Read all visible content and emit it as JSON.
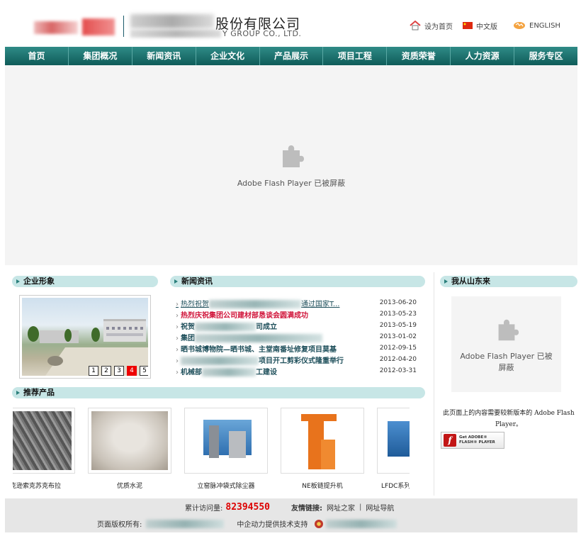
{
  "header": {
    "company_cn": "股份有限公司",
    "company_en": "Y GROUP CO., LTD.",
    "top_links": [
      {
        "label": "设为首页",
        "icon": "home-icon"
      },
      {
        "label": "中文版",
        "icon": "china-flag-icon"
      },
      {
        "label": "ENGLISH",
        "icon": "globe-icon"
      }
    ]
  },
  "nav": [
    "首页",
    "集团概况",
    "新闻资讯",
    "企业文化",
    "产品展示",
    "项目工程",
    "资质荣誉",
    "人力资源",
    "服务专区"
  ],
  "flash_blocked": "Adobe Flash Player 已被屏蔽",
  "sections": {
    "company_image": "企业形象",
    "news": "新闻资讯",
    "products": "推荐产品",
    "shandong": "我从山东来"
  },
  "pager": [
    "1",
    "2",
    "3",
    "4",
    "5"
  ],
  "pager_active": 3,
  "news": [
    {
      "pre": "热烈祝贺",
      "post": "通过国家T...",
      "date": "2013-06-20"
    },
    {
      "pre": "热烈庆祝集团公司建材部恳谈会圆满成功",
      "post": "",
      "date": "2013-05-23"
    },
    {
      "pre": "祝贺",
      "post": "司成立",
      "date": "2013-05-19"
    },
    {
      "pre": "集团",
      "post": "",
      "date": "2013-01-02"
    },
    {
      "pre": "晒书城博物院—晒书城、",
      "post": "主堂南番址修复项目莫基",
      "date": "2012-09-15"
    },
    {
      "pre": "",
      "post": "项目开工剪彩仪式隆重举行",
      "date": "2012-04-20"
    },
    {
      "pre": "机械部",
      "post": "工建设",
      "date": "2012-03-31"
    }
  ],
  "products": [
    {
      "label": "克逊索克苏克布拉"
    },
    {
      "label": "优质水泥"
    },
    {
      "label": "立窑脉冲袋式除尘器"
    },
    {
      "label": "NE板链提升机"
    },
    {
      "label": "LFDC系列"
    }
  ],
  "right_note": "此页面上的内容需要较新版本的 Adobe Flash Player。",
  "get_flash": {
    "line1": "Get ADOBE®",
    "line2": "FLASH® PLAYER"
  },
  "footer": {
    "visits_label": "累计访问量:",
    "visits_value": "82394550",
    "links_label": "友情链接:",
    "link1": "网址之家",
    "link_sep": "|",
    "link2": "网址导航",
    "copyright_label": "页面版权所有:",
    "tech_support": "中企动力提供技术支持"
  }
}
